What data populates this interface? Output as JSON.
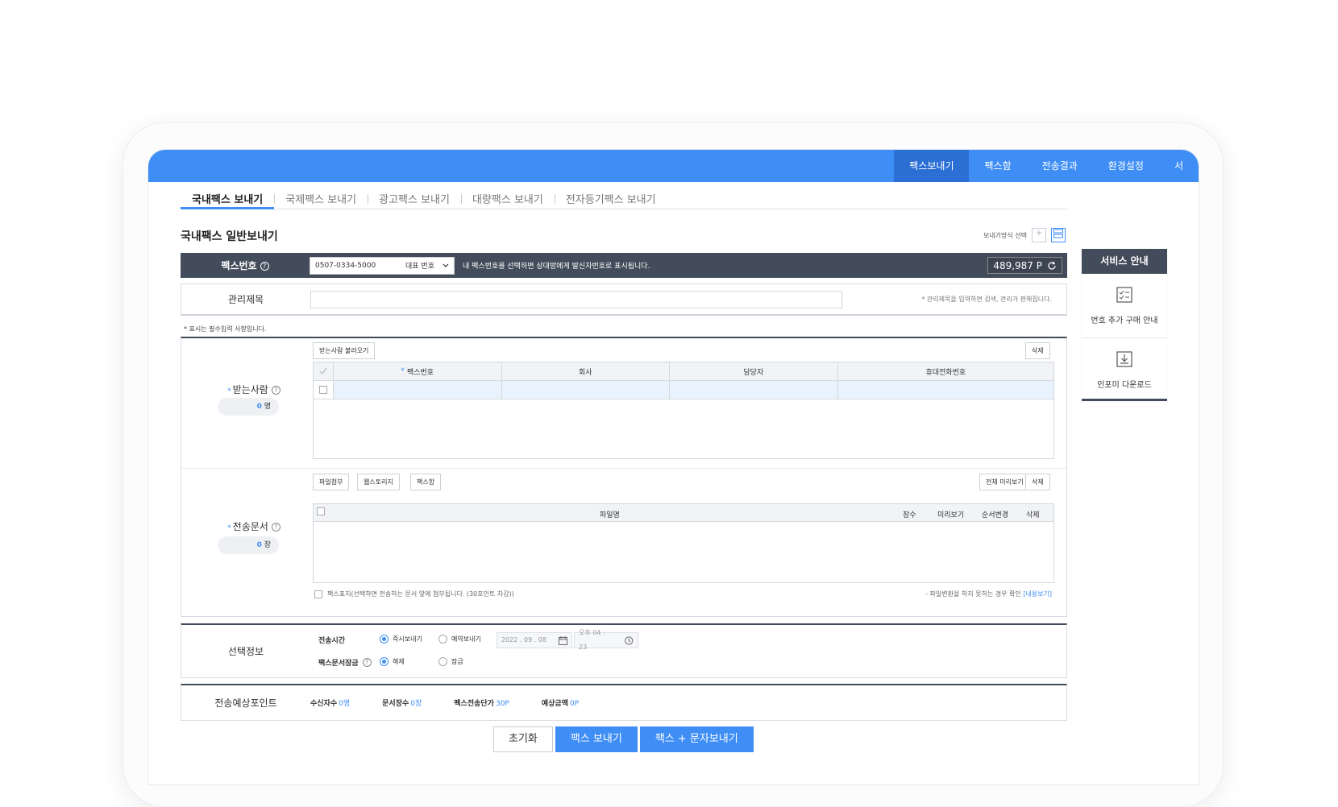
{
  "topnav": [
    "팩스보내기",
    "팩스함",
    "전송결과",
    "환경설정",
    "서"
  ],
  "subtabs": [
    "국내팩스 보내기",
    "국제팩스 보내기",
    "광고팩스 보내기",
    "대량팩스 보내기",
    "전자등기팩스 보내기"
  ],
  "page_title": "국내팩스 일반보내기",
  "send_method_label": "보내기방식 선택",
  "fax_bar": {
    "label": "팩스번호",
    "number": "0507-0334-5000",
    "rep_label": "대표 번호",
    "note": "내 팩스번호를 선택하면 상대방에게 발신자번호로 표시됩니다.",
    "points": "489,987 P"
  },
  "service": {
    "title": "서비스 안내",
    "items": [
      "번호 추가 구매 안내",
      "인포미 다운로드"
    ]
  },
  "mgmt": {
    "label": "관리제목",
    "value": "",
    "hint": "* 관리제목을 입력하면 검색, 관리가 편해집니다."
  },
  "required_note": "* 표시는 필수입력 사항입니다.",
  "recipient": {
    "label": "받는사람",
    "count_num": "0",
    "count_unit": "명",
    "load_button": "받는사람 불러오기",
    "delete_button": "삭제",
    "columns": [
      "팩스번호",
      "회사",
      "담당자",
      "휴대전화번호"
    ]
  },
  "document": {
    "label": "전송문서",
    "count_num": "0",
    "count_unit": "장",
    "attach_button": "파일첨부",
    "webstorage_button": "웹스토리지",
    "faxbox_button": "팩스함",
    "preview_all_button": "전체 미리보기",
    "delete_button": "삭제",
    "columns": [
      "파일명",
      "장수",
      "미리보기",
      "순서변경",
      "삭제"
    ],
    "cover_note": "팩스표지(선택하면 전송하는 문서 앞에 첨부됩니다. (30포인트 차감))",
    "conv_note": "- 파일변환을 하지 못하는 경우 확인",
    "conv_link": "[내용보기]"
  },
  "options": {
    "label": "선택정보",
    "send_time_label": "전송시간",
    "instant": "즉시보내기",
    "reserve": "예약보내기",
    "date": "2022 . 09 . 08",
    "time": "오후 04 : 23",
    "lock_label": "팩스문서잠금",
    "unlock": "해제",
    "lock": "잠금"
  },
  "estimate": {
    "label": "전송예상포인트",
    "items": [
      {
        "label": "수신자수",
        "value": "0명"
      },
      {
        "label": "문서장수",
        "value": "0장"
      },
      {
        "label": "팩스전송단가",
        "value": "30P"
      },
      {
        "label": "예상금액",
        "value": "0P"
      }
    ]
  },
  "buttons": {
    "reset": "초기화",
    "send_fax": "팩스 보내기",
    "send_fax_sms": "팩스 + 문자보내기"
  },
  "colors": {
    "accent": "#3f8ef5",
    "dark": "#434c5a"
  }
}
